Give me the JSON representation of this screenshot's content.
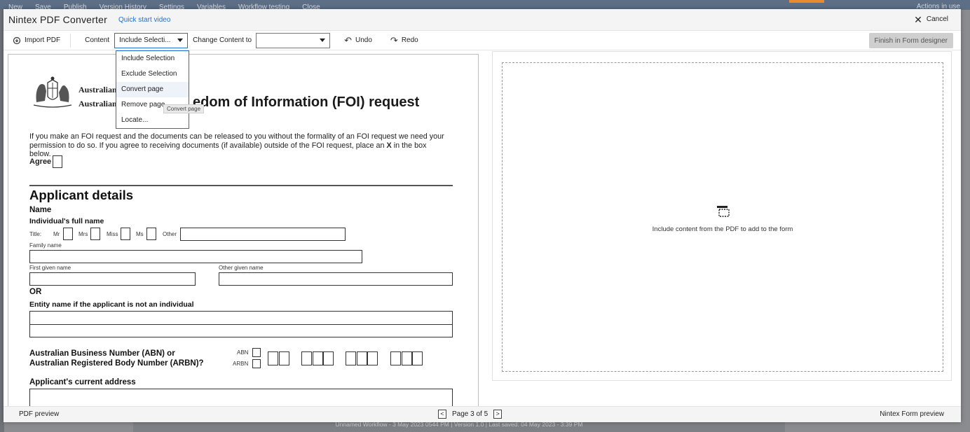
{
  "background_app": {
    "toolbar_items": [
      "New",
      "Save",
      "Publish",
      "Version History",
      "Settings",
      "Variables",
      "Workflow testing",
      "Close"
    ],
    "right_label": "Actions in use",
    "footer_text": "Unnamed Workflow - 3 May 2023 0544 PM  |  Version 1.0  |  Last saved: 04 May 2023 - 3:39 PM"
  },
  "modal": {
    "title": "Nintex PDF Converter",
    "quick_start_link": "Quick start video",
    "cancel_label": "Cancel"
  },
  "toolbar": {
    "import_label": "Import PDF",
    "content_label": "Content",
    "content_value": "Include Selecti...",
    "change_content_label": "Change Content to",
    "change_content_value": "",
    "undo_label": "Undo",
    "redo_label": "Redo",
    "finish_label": "Finish in Form designer"
  },
  "dropdown": {
    "items": [
      "Include Selection",
      "Exclude Selection",
      "Convert page",
      "Remove page",
      "Locate..."
    ],
    "tooltip": "Convert page"
  },
  "pdf": {
    "agency_line1": "Australian",
    "agency_line2": "Australian",
    "title": "Freedom of Information (FOI) request",
    "visible_title": "edom of Information (FOI) request",
    "intro_line1": "If you make an FOI request and the documents can be released to you without the formality of an FOI request we need your",
    "intro_line2": "permission to do so. If you agree to receiving documents (if available) outside of the FOI request, place an",
    "intro_x": "X",
    "intro_end": "in the box below.",
    "agree_label": "Agree",
    "section_title": "Applicant details",
    "name_heading": "Name",
    "full_name_heading": "Individual's full name",
    "title_label": "Title:",
    "title_options": [
      "Mr",
      "Mrs",
      "Miss",
      "Ms",
      "Other"
    ],
    "family_name": "Family name",
    "first_given": "First given name",
    "other_given": "Other given name",
    "or_label": "OR",
    "entity_label": "Entity name if the applicant is not an individual",
    "abn_line1": "Australian Business Number (ABN) or",
    "abn_line2": "Australian Registered Body Number (ARBN)?",
    "abn_label": "ABN",
    "arbn_label": "ARBN",
    "address_label": "Applicant's current address"
  },
  "preview": {
    "empty_message": "Include content from the PDF to add to the form"
  },
  "footer": {
    "left_label": "PDF preview",
    "page_text": "Page 3 of 5",
    "prev": "<",
    "next": ">",
    "right_label": "Nintex Form preview"
  },
  "colors": {
    "accent": "#1f6fd6",
    "finish_button_bg": "#cfcfcf",
    "titlebar_bg": "#f4f4f4"
  }
}
